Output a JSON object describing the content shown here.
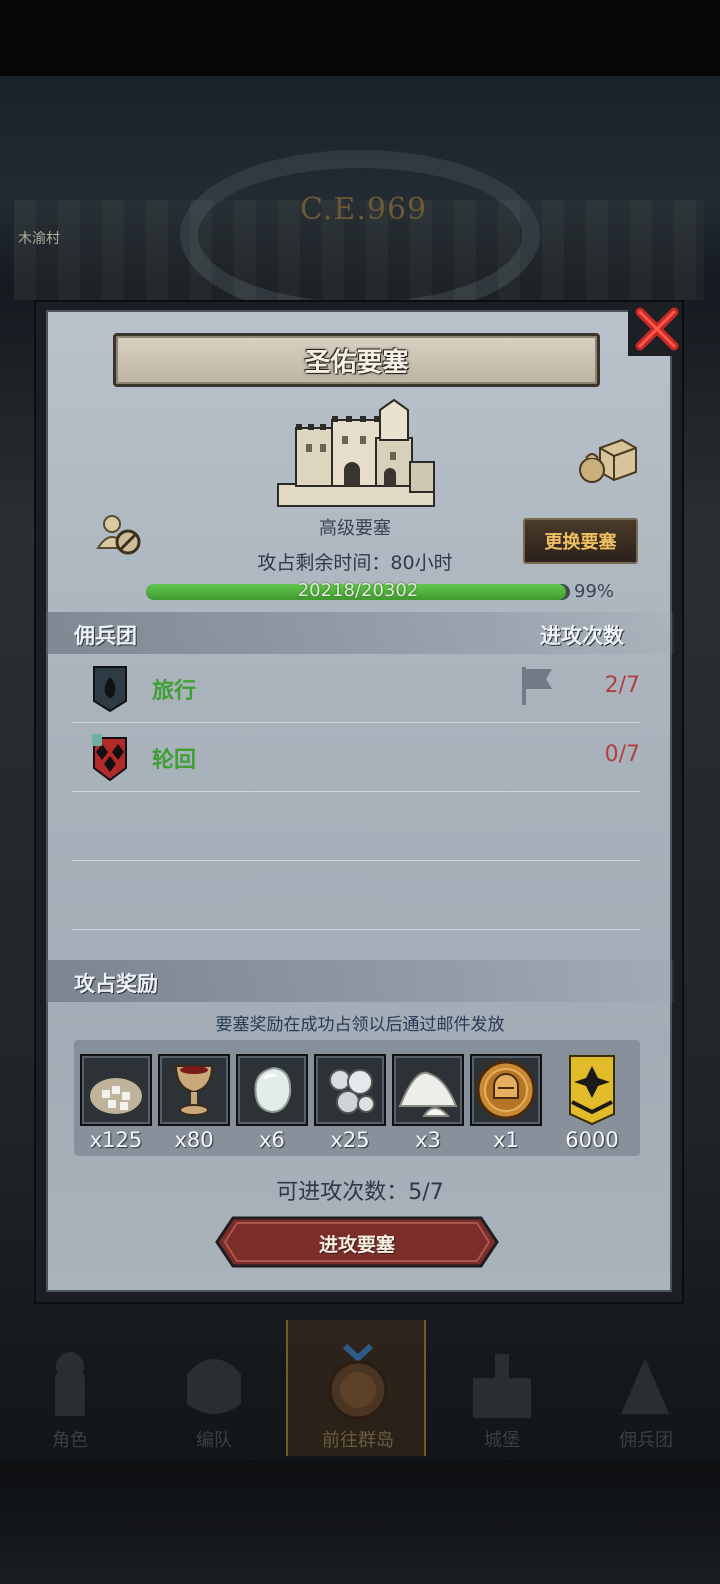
{
  "background": {
    "era_label": "C.E.969",
    "village_label": "木渝村"
  },
  "panel": {
    "title": "圣佑要塞",
    "fort_level": "高级要塞",
    "change_button": "更换要塞",
    "time_left": "攻占剩余时间：80小时",
    "progress": {
      "text": "20218/20302",
      "percent_label": "99%",
      "value": 0.99
    }
  },
  "mercenary_section": {
    "title": "佣兵团",
    "count_header": "进攻次数",
    "rows": [
      {
        "name": "旅行",
        "count": "2/7"
      },
      {
        "name": "轮回",
        "count": "0/7"
      }
    ]
  },
  "reward_section": {
    "title": "攻占奖励",
    "note": "要塞奖励在成功占领以后通过邮件发放",
    "items": [
      {
        "icon": "sugar-sack-icon",
        "qty": "x125"
      },
      {
        "icon": "goblet-icon",
        "qty": "x80"
      },
      {
        "icon": "pearl-stone-icon",
        "qty": "x6"
      },
      {
        "icon": "silver-ore-icon",
        "qty": "x25"
      },
      {
        "icon": "salt-pile-icon",
        "qty": "x3"
      },
      {
        "icon": "knight-medal-icon",
        "qty": "x1"
      },
      {
        "icon": "rank-badge-icon",
        "qty": "6000"
      }
    ]
  },
  "attempts_label": "可进攻次数：5/7",
  "attack_button": "进攻要塞",
  "nav": {
    "items": [
      {
        "label": "角色"
      },
      {
        "label": "编队"
      },
      {
        "label": "前往群岛"
      },
      {
        "label": "城堡"
      },
      {
        "label": "佣兵团"
      }
    ]
  },
  "colors": {
    "progress_green": "#52b83e",
    "name_green": "#3f9f35",
    "count_red": "#b04040",
    "accent_gold": "#f0c060"
  }
}
